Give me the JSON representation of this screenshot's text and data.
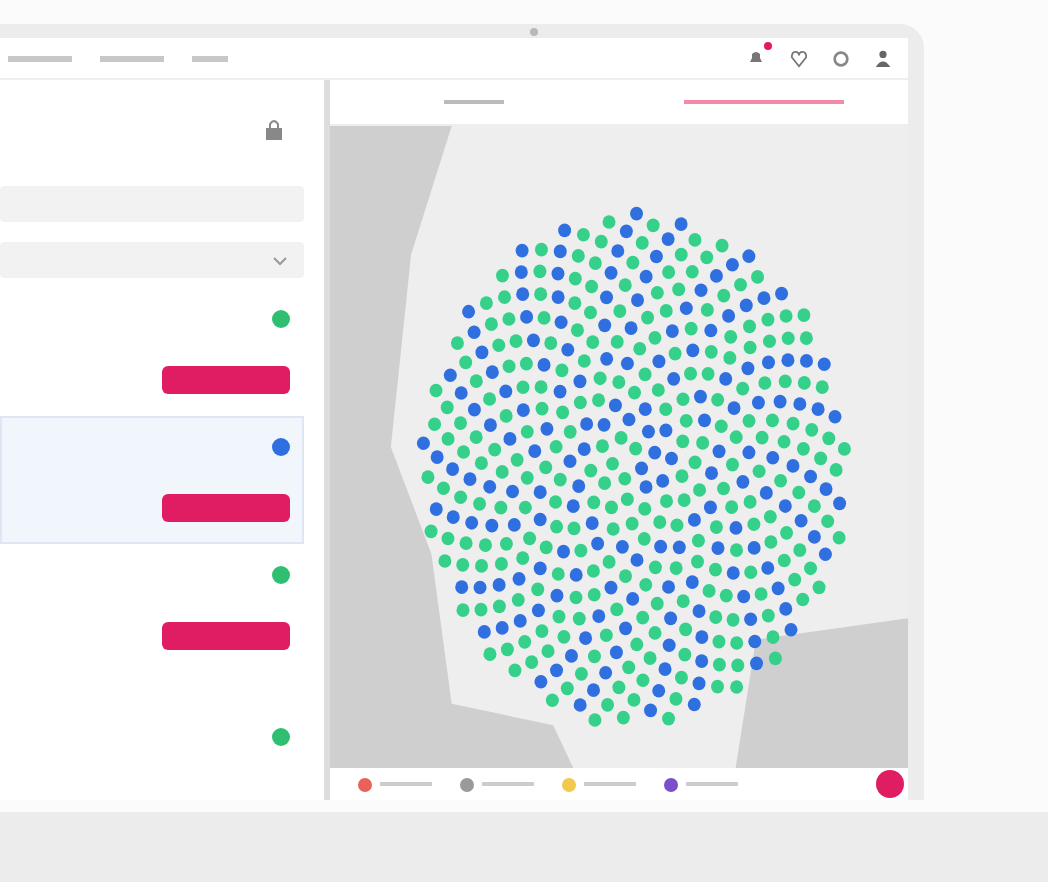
{
  "nav": {
    "notification_badge": true
  },
  "tabs": [
    {
      "selected": false
    },
    {
      "selected": true
    }
  ],
  "cards": [
    {
      "color": "#2fbf71",
      "selected": false
    },
    {
      "color": "#2f6fe0",
      "selected": true
    },
    {
      "color": "#2fbf71",
      "selected": false
    },
    {
      "color": "#2fbf71",
      "selected": false
    }
  ],
  "legend": [
    {
      "color": "#e8625a"
    },
    {
      "color": "#9a9a9a"
    },
    {
      "color": "#f2c94c"
    },
    {
      "color": "#7b4fc9"
    }
  ]
}
